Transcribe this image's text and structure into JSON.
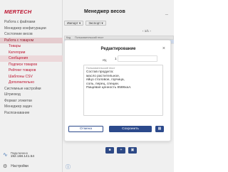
{
  "app": {
    "logo": "MERTECH",
    "title": "Менеджер весов",
    "minimize": "_"
  },
  "sidebar": {
    "items": [
      {
        "label": "Работа с файлами",
        "type": "top"
      },
      {
        "label": "Менеджер конфигурации",
        "type": "top"
      },
      {
        "label": "Состояние весов",
        "type": "top"
      },
      {
        "label": "Работа с товаром",
        "type": "active"
      },
      {
        "label": "Товары",
        "type": "sub"
      },
      {
        "label": "Категории",
        "type": "sub"
      },
      {
        "label": "Сообщения",
        "type": "sub-current"
      },
      {
        "label": "Подписи товаров",
        "type": "sub"
      },
      {
        "label": "Рейтинг товаров",
        "type": "sub"
      },
      {
        "label": "Шаблоны CSV",
        "type": "sub"
      },
      {
        "label": "Дополнительно",
        "type": "sub"
      },
      {
        "label": "Системные настройки",
        "type": "top"
      },
      {
        "label": "Штрихкод",
        "type": "top"
      },
      {
        "label": "Формат этикетки",
        "type": "top"
      },
      {
        "label": "Менеджер задач",
        "type": "top"
      },
      {
        "label": "Распознавание",
        "type": "top"
      }
    ],
    "network_label": "Подключено",
    "network_ip": "192.168.141.54",
    "settings_label": "Настройки"
  },
  "toolbar": {
    "import_label": "Импорт ▾",
    "export_label": "Экспорт ▾"
  },
  "pager": {
    "text": "‹ 1/1 ›"
  },
  "table": {
    "headers": [
      "Код",
      "Пользовательский текст"
    ],
    "rows": [
      {
        "code": "1",
        "text": "Состав продукта:"
      }
    ]
  },
  "modal": {
    "title": "Редактирование",
    "id_label": "Ид",
    "id_value": "1",
    "field_label": "Пользовательский текст",
    "text_lines": [
      "Состав продукта:",
      "масло растительное,",
      "яйцо столовое, горчица,",
      "соль, перец, специи.",
      "Пищевая ценность 858Ккал."
    ],
    "cancel_label": "Отмена",
    "save_label": "Сохранить"
  },
  "bottom": {
    "icons": [
      "delete-icon",
      "add-icon",
      "folder-icon"
    ]
  },
  "colors": {
    "brand": "#c8102e",
    "primary": "#2c4a8c",
    "active_bg": "#f4d8dc"
  }
}
